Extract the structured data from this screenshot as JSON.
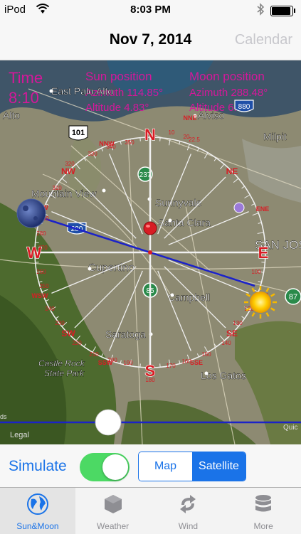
{
  "status_bar": {
    "carrier": "iPod",
    "time": "8:03 PM"
  },
  "nav": {
    "title": "Nov 7, 2014",
    "right_button": "Calendar"
  },
  "overlay": {
    "time_label": "Time",
    "time_value": "8:10",
    "sun_title": "Sun position",
    "sun_azimuth": "Azimuth 114.85°",
    "sun_altitude": "Altitude 4.83°",
    "moon_title": "Moon position",
    "moon_azimuth": "Azimuth 288.48°",
    "moon_altitude": "Altitude 6.05°"
  },
  "map_places": {
    "east_palo_alto": "East Palo Alto",
    "alto": "Alto",
    "alviso": "Alviso",
    "milpitas": "Milpit",
    "mountain_view": "Mountain View",
    "sunnyvale": "Sunnyvale",
    "santa_clara": "Santa Clara",
    "san_jose": "SAN JOS",
    "cupertino": "Cupertino",
    "campbell": "Campbell",
    "saratoga": "Saratoga",
    "los_gatos": "Los Gatos",
    "castle_rock": "Castle Rock",
    "state_park": "State Park",
    "legal": "Legal",
    "slider_left_label": "ds",
    "slider_right_label": "Quic"
  },
  "highway_shields": [
    "101",
    "237",
    "280",
    "85",
    "87",
    "880"
  ],
  "compass": {
    "cardinals": {
      "n": "N",
      "e": "E",
      "s": "S",
      "w": "W"
    },
    "directions": {
      "nne": "NNE",
      "ne": "NE",
      "ene": "ENE",
      "ese": "ESE",
      "se": "SE",
      "sse": "SSE",
      "ssw": "SSW",
      "sw": "SW",
      "wsw": "WSW",
      "wnw": "WNW",
      "nw": "NW",
      "nnw": "NNW"
    },
    "degrees": {
      "d10": "10",
      "d20": "20",
      "d22": "22.5",
      "d350": "350",
      "d340": "340",
      "d330": "330",
      "d320": "320",
      "d310": "310",
      "d290": "290",
      "d280": "280",
      "d270": "270",
      "d260": "260",
      "d250": "250",
      "d240": "240",
      "d230": "230",
      "d220": "220",
      "d210": "210",
      "d200": "200",
      "d190": "190",
      "d180": "180",
      "d170": "170",
      "d160": "160",
      "d150": "150",
      "d140": "140",
      "d130": "130",
      "d120": "120",
      "d100": "100"
    }
  },
  "time_slider_fraction": 0.36,
  "controls": {
    "simulate_label": "Simulate",
    "simulate_on": true,
    "segments": [
      "Map",
      "Satellite"
    ],
    "selected_segment": "Satellite"
  },
  "tabs": [
    {
      "label": "Sun&Moon",
      "icon": "globe-icon",
      "active": true
    },
    {
      "label": "Weather",
      "icon": "cube-icon",
      "active": false
    },
    {
      "label": "Wind",
      "icon": "arrows-icon",
      "active": false
    },
    {
      "label": "More",
      "icon": "database-icon",
      "active": false
    }
  ],
  "colors": {
    "accent": "#1a73e8",
    "overlay_text": "#d4189a",
    "compass_red": "#d81d24",
    "sun_line": "#1b22c8"
  }
}
